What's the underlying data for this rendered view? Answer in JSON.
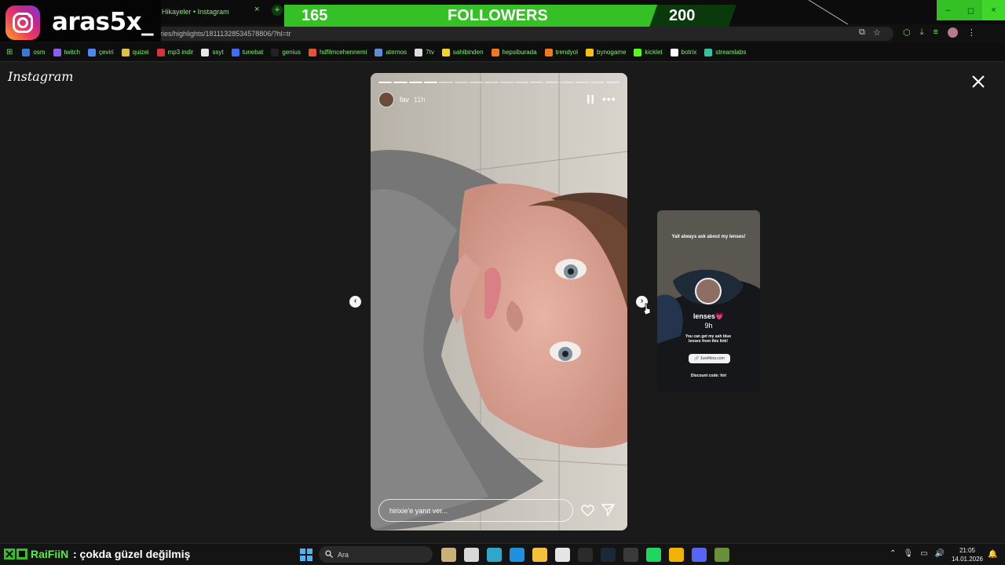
{
  "browser": {
    "tab_title": "Hikayeler • Instagram",
    "tab_close": "×",
    "new_tab": "+",
    "url": "ries/highlights/18111328534578806/?hl=tr",
    "window_buttons": [
      "–",
      "◻",
      "×"
    ],
    "bookmarks": [
      {
        "label": "osm",
        "color": "#3a78d6"
      },
      {
        "label": "twitch",
        "color": "#8f5cf2"
      },
      {
        "label": "çeviri",
        "color": "#4d86ec"
      },
      {
        "label": "quizei",
        "color": "#e2c044"
      },
      {
        "label": "mp3 indir",
        "color": "#d9323f"
      },
      {
        "label": "ssyt",
        "color": "#e8e8e8"
      },
      {
        "label": "tunebat",
        "color": "#3d6cf5"
      },
      {
        "label": "genius",
        "color": "#222222"
      },
      {
        "label": "hdfilmcehennemi",
        "color": "#e0562f"
      },
      {
        "label": "aternos",
        "color": "#5c8dd6"
      },
      {
        "label": "7tv",
        "color": "#dddddd"
      },
      {
        "label": "sahibinden",
        "color": "#f3d32c"
      },
      {
        "label": "hepsiburada",
        "color": "#f07820"
      },
      {
        "label": "trendyol",
        "color": "#f27a1a"
      },
      {
        "label": "bynogame",
        "color": "#f4c20d"
      },
      {
        "label": "kicklet",
        "color": "#53fc18"
      },
      {
        "label": "botrix",
        "color": "#ffffff"
      },
      {
        "label": "streamlabs",
        "color": "#31c3a2"
      }
    ]
  },
  "overlay": {
    "handle": "aras5x_",
    "followers_current": "165",
    "followers_label": "FOLLOWERS",
    "followers_goal": "200",
    "progress_fraction": 0.825,
    "accent": "#35c025"
  },
  "viewer": {
    "wordmark": "Instagram",
    "story": {
      "username": "fav",
      "time": "11h",
      "segments_total": 16,
      "segments_done": 4,
      "more": "•••",
      "reply_placeholder": "hirixie'e yanıt ver..."
    },
    "nav_prev": "‹",
    "nav_next": "›",
    "next_story": {
      "caption": "Yall always ask about my lenses!",
      "name": "lenses💗",
      "time": "9h",
      "description": "You can get my ash blue lenses from this link!",
      "link": "Just4kira.com",
      "discount": "Discount code: hiri"
    }
  },
  "taskbar": {
    "chat_user": "RaiFiiN",
    "chat_message": ": çokda güzel değilmiş",
    "search_placeholder": "Ara",
    "apps": [
      {
        "name": "widgets",
        "color": "#c9b27a"
      },
      {
        "name": "task-view",
        "color": "#d8d8d8"
      },
      {
        "name": "edge-alt",
        "color": "#2fa7c9"
      },
      {
        "name": "edge",
        "color": "#1f8fe0"
      },
      {
        "name": "file-explorer",
        "color": "#f2c23c"
      },
      {
        "name": "store",
        "color": "#e5e5e5"
      },
      {
        "name": "epic-games",
        "color": "#2b2b2b"
      },
      {
        "name": "steam",
        "color": "#1b2838"
      },
      {
        "name": "obs",
        "color": "#3a3a3a"
      },
      {
        "name": "spotify",
        "color": "#1ed760"
      },
      {
        "name": "chrome",
        "color": "#f0b400"
      },
      {
        "name": "discord",
        "color": "#5865f2"
      },
      {
        "name": "minecraft",
        "color": "#6a8f3a"
      }
    ],
    "clock_time": "21:05",
    "clock_date": "14.01.2026"
  }
}
